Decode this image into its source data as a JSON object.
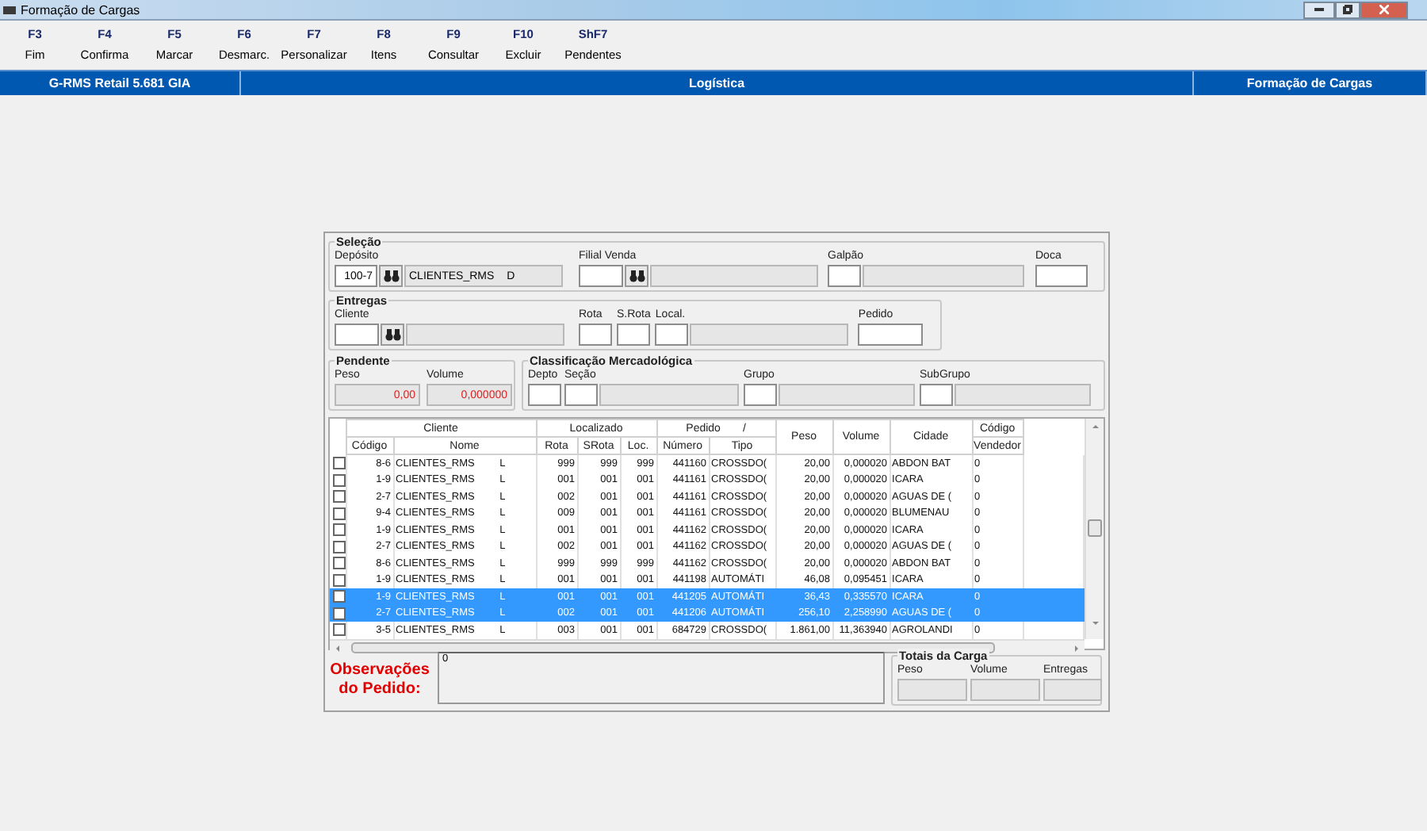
{
  "window": {
    "title": "Formação de Cargas"
  },
  "toolbar": [
    {
      "key": "F3",
      "label": "Fim"
    },
    {
      "key": "F4",
      "label": "Confirma"
    },
    {
      "key": "F5",
      "label": "Marcar"
    },
    {
      "key": "F6",
      "label": "Desmarc."
    },
    {
      "key": "F7",
      "label": "Personalizar"
    },
    {
      "key": "F8",
      "label": "Itens"
    },
    {
      "key": "F9",
      "label": "Consultar"
    },
    {
      "key": "F10",
      "label": "Excluir"
    },
    {
      "key": "ShF7",
      "label": "Pendentes"
    }
  ],
  "header_band": {
    "application": "G-RMS Retail 5.681 GIA",
    "module": "Logística",
    "screen": "Formação de Cargas"
  },
  "selecao": {
    "title": "Seleção",
    "fields": [
      {
        "label": "Depósito",
        "value": "100-7",
        "lookup": true,
        "description": "CLIENTES_RMS D"
      },
      {
        "label": "Filial Venda",
        "lookup": true
      },
      {
        "label": "Galpão",
        "lookup": false
      },
      {
        "label": "Doca",
        "lookup": false
      }
    ]
  },
  "entregas": {
    "title": "Entregas",
    "fields": [
      {
        "label": "Cliente",
        "lookup": true
      },
      {
        "label": "Rota",
        "lookup": false
      },
      {
        "label": "S.Rota",
        "lookup": false
      },
      {
        "label": "Local.",
        "lookup": false
      },
      {
        "label": "Pedido",
        "lookup": false
      }
    ]
  },
  "pendente": {
    "title": "Pendente",
    "fields": [
      {
        "label": "Peso",
        "value": "0,00"
      },
      {
        "label": "Volume",
        "value": "0,000000"
      }
    ]
  },
  "classificacao": {
    "title": "Classificação Mercadológica",
    "fields": [
      {
        "label": "Depto"
      },
      {
        "label": "Seção"
      },
      {
        "label": "Grupo"
      },
      {
        "label": "SubGrupo"
      }
    ]
  },
  "table": {
    "groups": [
      {
        "label": "Cliente"
      },
      {
        "label": "Localizado"
      },
      {
        "label": "Pedido",
        "sort_mark": "/"
      },
      {
        "label": "Código"
      }
    ],
    "columns": [
      "Código",
      "Nome",
      "Rota",
      "SRota",
      "Loc.",
      "Número",
      "Tipo",
      "Peso",
      "Volume",
      "Cidade",
      "Vendedor"
    ],
    "rows": [
      {
        "checked": false,
        "selected": false,
        "cells": [
          "8-6",
          "CLIENTES_RMS L",
          "999",
          "999",
          "999",
          "441160",
          "CROSSDO(",
          "20,00",
          "0,000020",
          "ABDON BAT",
          "0"
        ]
      },
      {
        "checked": false,
        "selected": false,
        "cells": [
          "1-9",
          "CLIENTES_RMS L",
          "001",
          "001",
          "001",
          "441161",
          "CROSSDO(",
          "20,00",
          "0,000020",
          "ICARA",
          "0"
        ]
      },
      {
        "checked": false,
        "selected": false,
        "cells": [
          "2-7",
          "CLIENTES_RMS L",
          "002",
          "001",
          "001",
          "441161",
          "CROSSDO(",
          "20,00",
          "0,000020",
          "AGUAS DE (",
          "0"
        ]
      },
      {
        "checked": false,
        "selected": false,
        "cells": [
          "9-4",
          "CLIENTES_RMS L",
          "009",
          "001",
          "001",
          "441161",
          "CROSSDO(",
          "20,00",
          "0,000020",
          "BLUMENAU",
          "0"
        ]
      },
      {
        "checked": false,
        "selected": false,
        "cells": [
          "1-9",
          "CLIENTES_RMS L",
          "001",
          "001",
          "001",
          "441162",
          "CROSSDO(",
          "20,00",
          "0,000020",
          "ICARA",
          "0"
        ]
      },
      {
        "checked": false,
        "selected": false,
        "cells": [
          "2-7",
          "CLIENTES_RMS L",
          "002",
          "001",
          "001",
          "441162",
          "CROSSDO(",
          "20,00",
          "0,000020",
          "AGUAS DE (",
          "0"
        ]
      },
      {
        "checked": false,
        "selected": false,
        "cells": [
          "8-6",
          "CLIENTES_RMS L",
          "999",
          "999",
          "999",
          "441162",
          "CROSSDO(",
          "20,00",
          "0,000020",
          "ABDON BAT",
          "0"
        ]
      },
      {
        "checked": false,
        "selected": false,
        "cells": [
          "1-9",
          "CLIENTES_RMS L",
          "001",
          "001",
          "001",
          "441198",
          "AUTOMÁTI",
          "46,08",
          "0,095451",
          "ICARA",
          "0"
        ]
      },
      {
        "checked": false,
        "selected": true,
        "cells": [
          "1-9",
          "CLIENTES_RMS L",
          "001",
          "001",
          "001",
          "441205",
          "AUTOMÁTI",
          "36,43",
          "0,335570",
          "ICARA",
          "0"
        ]
      },
      {
        "checked": false,
        "selected": true,
        "cells": [
          "2-7",
          "CLIENTES_RMS L",
          "002",
          "001",
          "001",
          "441206",
          "AUTOMÁTI",
          "256,10",
          "2,258990",
          "AGUAS DE (",
          "0"
        ]
      },
      {
        "checked": false,
        "selected": false,
        "cells": [
          "3-5",
          "CLIENTES_RMS L",
          "003",
          "001",
          "001",
          "684729",
          "CROSSDO(",
          "1.861,00",
          "11,363940",
          "AGROLANDI",
          "0"
        ]
      }
    ]
  },
  "observacoes": {
    "label": "Observações do Pedido:",
    "value": "0"
  },
  "totais": {
    "title": "Totais da Carga",
    "fields": [
      {
        "label": "Peso"
      },
      {
        "label": "Volume"
      },
      {
        "label": "Entregas"
      }
    ]
  }
}
